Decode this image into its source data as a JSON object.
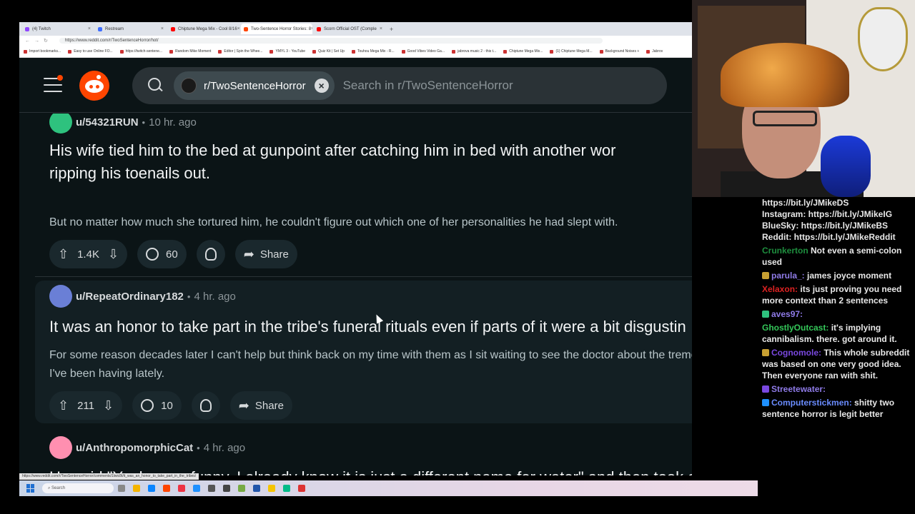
{
  "browser": {
    "tabs": [
      {
        "label": "(4) Twitch",
        "color": "#9146ff"
      },
      {
        "label": "Restream",
        "color": "#3d6dff"
      },
      {
        "label": "Chiptune Mega Mix - Cool 8/16",
        "color": "#ff0000"
      },
      {
        "label": "Two-Sentence Horror Stories: 8",
        "color": "#ff4500"
      },
      {
        "label": "Scorn Official OST (Comple",
        "color": "#ff0000"
      }
    ],
    "new_tab": "+",
    "url": "https://www.reddit.com/r/TwoSentenceHorror/hot/",
    "bookmarks": [
      "Import bookmarks...",
      "Easy to use Online FO...",
      "https://twitch-sentene...",
      "Random Mike Moment",
      "Editor | Spin the Whee...",
      "YMYL 3 - YouTube",
      "Quiz Kit | Set Up",
      "Touhou Mega Mix - R...",
      "Good Vibes Video Ga...",
      "jabrova music 2 - this t...",
      "Chiptune Mega Mix...",
      "(1) Chiptune Mega M...",
      "Background Noises +",
      "Jabrov"
    ],
    "status_url": "https://www.reddit.com/r/TwoSentenceHorror/comments/1lwic8t/it_was_an_honor_to_take_part_in_the_tribes/"
  },
  "header": {
    "subreddit": "r/TwoSentenceHorror",
    "search_placeholder": "Search in r/TwoSentenceHorror"
  },
  "posts": [
    {
      "user": "u/54321RUN",
      "time": "10 hr. ago",
      "title_line1": "His wife tied him to the bed at gunpoint after catching him in bed with another wor",
      "title_line2": "ripping his toenails out.",
      "body": "But no matter how much she tortured him, he couldn't figure out which one of her personalities he had slept with.",
      "votes": "1.4K",
      "comments": "60",
      "share": "Share",
      "avatar_color": "#2ec27e"
    },
    {
      "user": "u/RepeatOrdinary182",
      "time": "4 hr. ago",
      "title_line1": "It was an honor to take part in the tribe's funeral rituals even if parts of it were a bit disgustin",
      "body_line1": "For some reason decades later I can't help but think back on my time with them as I sit waiting to see the doctor about the tremors",
      "body_line2": "I've been having lately.",
      "votes": "211",
      "comments": "10",
      "share": "Share",
      "avatar_color": "#6a7fd6"
    },
    {
      "user": "u/AnthropomorphicCat",
      "time": "4 hr. ago",
      "title_line1": "He said \"Yeah, very funny, I already know it is just a different name for water\" and then took a large",
      "avatar_color": "#ff8fb0"
    }
  ],
  "taskbar": {
    "search_label": "Search",
    "icon_colors": [
      "#888",
      "#f4b400",
      "#0a84ff",
      "#ff4500",
      "#e34",
      "#1e90ff",
      "#555",
      "#444",
      "#7a4",
      "#2255aa",
      "#f5c400",
      "#0b8",
      "#d33"
    ]
  },
  "chat": [
    {
      "name": "",
      "name_color": "#e8e8e8",
      "text": "https://bit.ly/JMikeDS"
    },
    {
      "name": "",
      "name_color": "#e8e8e8",
      "text": "Instagram: https://bit.ly/JMikeIG"
    },
    {
      "name": "",
      "name_color": "#e8e8e8",
      "text": "BlueSky: https://bit.ly/JMikeBS"
    },
    {
      "name": "",
      "name_color": "#e8e8e8",
      "text": "Reddit: https://bit.ly/JMikeReddit"
    },
    {
      "name": "Crunkerton",
      "name_color": "#1e8e3e",
      "text": "Not even a semi-colon used"
    },
    {
      "name": "parula_:",
      "name_color": "#8f7be8",
      "text": "james joyce moment"
    },
    {
      "name": "Xelaxon:",
      "name_color": "#d22",
      "text": "its just proving you need more context than 2 sentences"
    },
    {
      "name": "aves97:",
      "name_color": "#8f7be8",
      "text": ""
    },
    {
      "name": "GhostlyOutcast:",
      "name_color": "#34c759",
      "text": "it's implying cannibalism. there. got around it."
    },
    {
      "name": "Cognomole:",
      "name_color": "#7a48e0",
      "text": "This whole subreddit was based on one very good idea. Then everyone ran with shit."
    },
    {
      "name": "Streetewater:",
      "name_color": "#8f7be8",
      "text": ""
    },
    {
      "name": "Computerstickmen:",
      "name_color": "#6a8cff",
      "text": "shitty two sentence horror is legit better"
    }
  ]
}
